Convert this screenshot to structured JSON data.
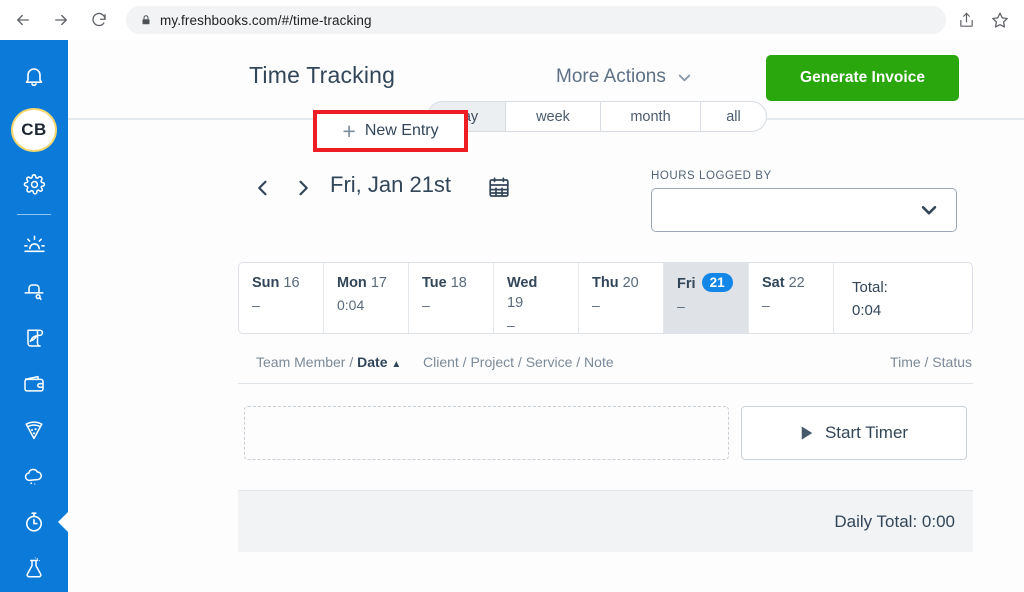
{
  "browser": {
    "url": "my.freshbooks.com/#/time-tracking",
    "back_icon": "back-arrow-icon",
    "forward_icon": "forward-arrow-icon",
    "reload_icon": "reload-icon",
    "lock_icon": "lock-icon",
    "share_icon": "share-icon",
    "bookmark_icon": "star-icon"
  },
  "sidebar": {
    "background": "#0b7ad8",
    "avatar_initials": "CB",
    "avatar_ring_color": "#f5d76e",
    "items": [
      {
        "name": "notifications",
        "icon": "bell-icon"
      },
      {
        "name": "settings",
        "icon": "gear-icon"
      },
      {
        "name": "dashboard",
        "icon": "sunrise-icon"
      },
      {
        "name": "clients",
        "icon": "bowler-hat-icon"
      },
      {
        "name": "invoices",
        "icon": "scroll-quill-icon"
      },
      {
        "name": "expenses",
        "icon": "wallet-icon"
      },
      {
        "name": "projects",
        "icon": "pizza-slice-icon"
      },
      {
        "name": "reports",
        "icon": "cloud-icon"
      },
      {
        "name": "time-tracking",
        "icon": "stopwatch-icon",
        "active": true
      },
      {
        "name": "beta-labs",
        "icon": "flask-icon"
      }
    ]
  },
  "header": {
    "title": "Time Tracking",
    "more_actions_label": "More Actions",
    "more_actions_icon": "chevron-down-icon",
    "generate_invoice_label": "Generate Invoice",
    "generate_invoice_color": "#2aa70d"
  },
  "tabs": {
    "selected": "day",
    "items": [
      {
        "label": "day",
        "selected": true
      },
      {
        "label": "week",
        "selected": false
      },
      {
        "label": "month",
        "selected": false
      },
      {
        "label": "all",
        "selected": false
      }
    ]
  },
  "date_nav": {
    "prev_icon": "chevron-left-icon",
    "next_icon": "chevron-right-icon",
    "date_label": "Fri, Jan 21st",
    "calendar_icon": "calendar-icon"
  },
  "hours_logged_by": {
    "label": "HOURS LOGGED BY",
    "value": "",
    "placeholder": "",
    "chevron_icon": "chevron-down-icon"
  },
  "week_strip": {
    "days": [
      {
        "weekday": "Sun",
        "date": "16",
        "value": "–",
        "selected": false
      },
      {
        "weekday": "Mon",
        "date": "17",
        "value": "0:04",
        "selected": false
      },
      {
        "weekday": "Tue",
        "date": "18",
        "value": "–",
        "selected": false
      },
      {
        "weekday": "Wed",
        "date": "19",
        "value": "–",
        "selected": false
      },
      {
        "weekday": "Thu",
        "date": "20",
        "value": "–",
        "selected": false
      },
      {
        "weekday": "Fri",
        "date": "21",
        "value": "–",
        "selected": true
      },
      {
        "weekday": "Sat",
        "date": "22",
        "value": "–",
        "selected": false
      }
    ],
    "total_label": "Total:",
    "total_value": "0:04",
    "selected_badge_color": "#1287e8"
  },
  "sort_header": {
    "left_prefix": "Team Member / ",
    "left_active": "Date",
    "sort_caret": "▲",
    "middle": "Client / Project / Service / Note",
    "right": "Time / Status"
  },
  "entry_row": {
    "new_entry_label": "New Entry",
    "new_entry_plus": "+",
    "new_entry_highlight_color": "#ee1c23",
    "start_timer_label": "Start Timer",
    "start_timer_icon": "play-icon"
  },
  "daily_total": {
    "text": "Daily Total: 0:00"
  }
}
